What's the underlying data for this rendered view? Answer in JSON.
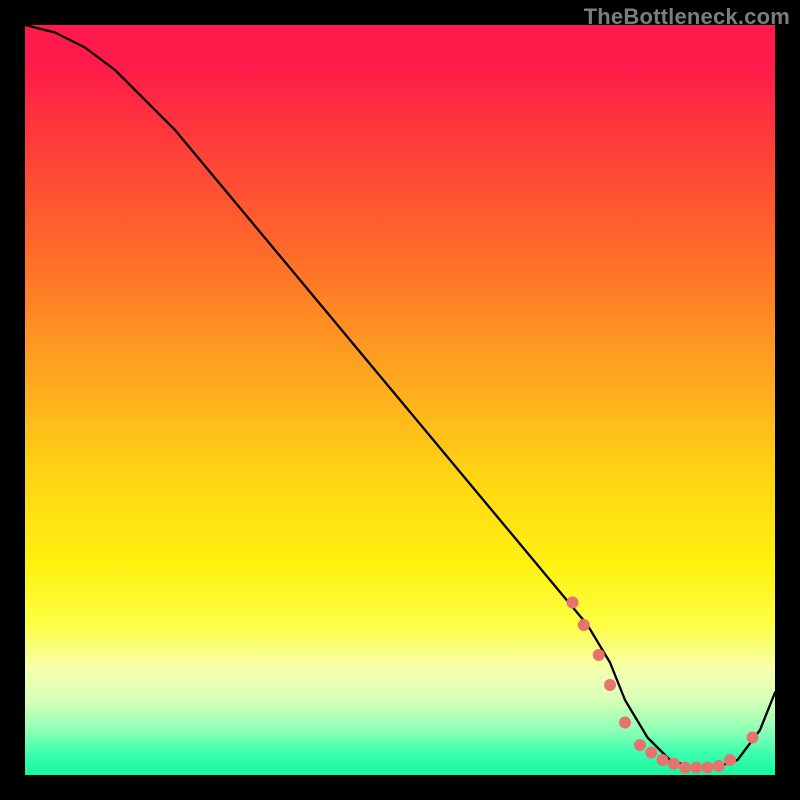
{
  "watermark": "TheBottleneck.com",
  "chart_data": {
    "type": "line",
    "title": "",
    "xlabel": "",
    "ylabel": "",
    "xlim": [
      0,
      100
    ],
    "ylim": [
      0,
      100
    ],
    "x": [
      0,
      4,
      8,
      12,
      20,
      30,
      40,
      50,
      60,
      70,
      75,
      78,
      80,
      83,
      86,
      89,
      92,
      95,
      98,
      100
    ],
    "values": [
      100,
      99,
      97,
      94,
      86,
      74,
      62,
      50,
      38,
      26,
      20,
      15,
      10,
      5,
      2,
      1,
      1,
      2,
      6,
      11
    ],
    "markers": {
      "x": [
        73,
        74.5,
        76.5,
        78,
        80,
        82,
        83.5,
        85,
        86.5,
        88,
        89.5,
        91,
        92.5,
        94,
        97
      ],
      "values": [
        23,
        20,
        16,
        12,
        7,
        4,
        3,
        2,
        1.5,
        1,
        1,
        1,
        1.2,
        2,
        5
      ],
      "color": "#e6736e",
      "size": 12
    }
  }
}
